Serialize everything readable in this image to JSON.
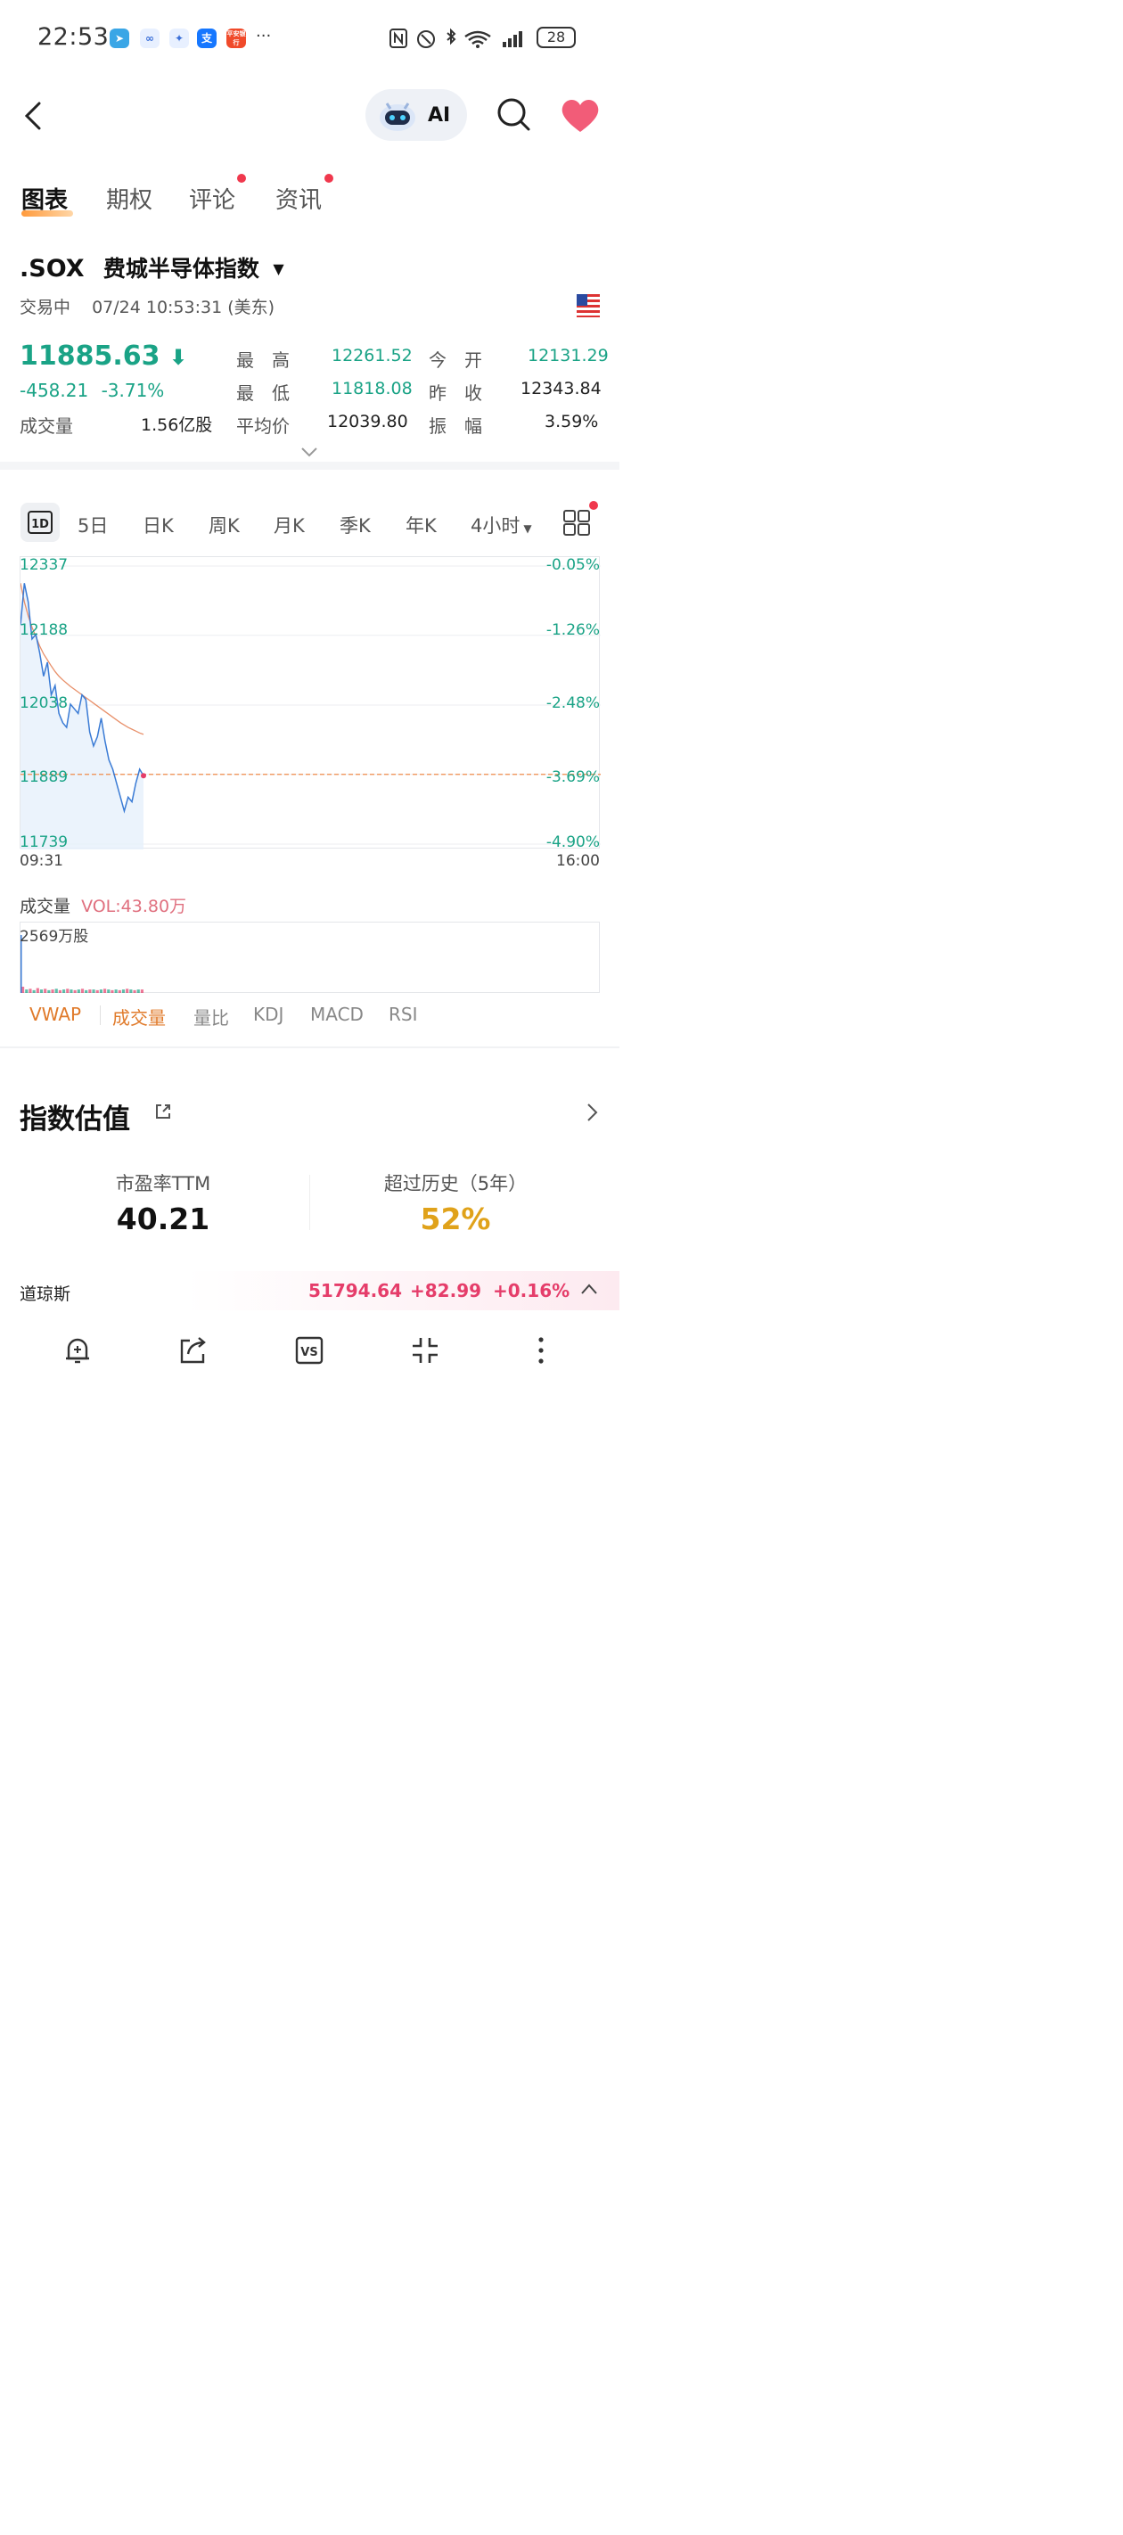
{
  "status_bar": {
    "time": "22:53",
    "more": "···",
    "battery": "28",
    "app_icons": [
      "telegram-icon",
      "app-icon",
      "rabbit-icon",
      "alipay-icon",
      "pingan-bank-icon"
    ],
    "pingan_text": "平安银行",
    "alipay_text": "支"
  },
  "header": {
    "ai_label": "AI"
  },
  "tabs": [
    {
      "label": "图表"
    },
    {
      "label": "期权"
    },
    {
      "label": "评论"
    },
    {
      "label": "资讯"
    }
  ],
  "quote": {
    "symbol": ".SOX",
    "name": "费城半导体指数",
    "status": "交易中",
    "datetime": "07/24 10:53:31 (美东)",
    "price": "11885.63",
    "change": "-458.21",
    "change_pct": "-3.71%",
    "volume_label": "成交量",
    "volume": "1.56亿股",
    "stats": [
      {
        "label": "最　高",
        "value": "12261.52",
        "color": "green"
      },
      {
        "label": "今　开",
        "value": "12131.29",
        "color": "green"
      },
      {
        "label": "最　低",
        "value": "11818.08",
        "color": "green"
      },
      {
        "label": "昨　收",
        "value": "12343.84",
        "color": "dark"
      },
      {
        "label": "平均价",
        "value": "12039.80",
        "color": "dark"
      },
      {
        "label": "振　幅",
        "value": "3.59%",
        "color": "dark"
      }
    ]
  },
  "periods": {
    "active": "1D",
    "items": [
      "5日",
      "日K",
      "周K",
      "月K",
      "季K",
      "年K",
      "4小时"
    ]
  },
  "chart": {
    "y_labels": [
      "12337",
      "12188",
      "12038",
      "11889",
      "11739"
    ],
    "pct_labels": [
      "-0.05%",
      "-1.26%",
      "-2.48%",
      "-3.69%",
      "-4.90%"
    ],
    "time_start": "09:31",
    "time_end": "16:00"
  },
  "chart_data": {
    "type": "line",
    "title": "",
    "x_range": [
      "09:31",
      "16:00"
    ],
    "ylim": [
      11739,
      12337
    ],
    "series": [
      {
        "values": [
          12210,
          12300,
          12260,
          12180,
          12190,
          12150,
          12100,
          12130,
          12060,
          12080,
          12020,
          12000,
          11990,
          12040,
          12030,
          12020,
          12060,
          12050,
          11980,
          11950,
          11970,
          12010,
          11960,
          11920,
          11900,
          11870,
          11840,
          11810,
          11840,
          11830,
          11870,
          11900,
          11886
        ]
      },
      {
        "values": [
          12300,
          12260,
          12230,
          12205,
          12185,
          12165,
          12148,
          12135,
          12122,
          12110,
          12100,
          12092,
          12085,
          12078,
          12072,
          12066,
          12060,
          12054,
          12048,
          12042,
          12036,
          12030,
          12024,
          12018,
          12012,
          12006,
          12000,
          11995,
          11990,
          11986,
          11982,
          11978,
          11975
        ]
      }
    ],
    "reference_line": 11889,
    "colors": {
      "price": "#3a7bd5",
      "avg": "#e8906a",
      "ref": "#f08a4b"
    }
  },
  "volume_section": {
    "title": "成交量",
    "vol_label": "VOL:43.80万",
    "axis_label": "2569万股"
  },
  "volume_data": {
    "values": [
      9,
      5,
      6,
      4,
      7,
      5,
      6,
      4,
      5,
      6,
      4,
      5,
      6,
      5,
      4,
      5,
      6,
      4,
      5,
      5,
      4,
      5,
      6,
      5,
      4,
      5,
      4,
      5,
      6,
      5,
      4,
      5,
      5
    ]
  },
  "indicators": [
    "VWAP",
    "成交量",
    "量比",
    "KDJ",
    "MACD",
    "RSI"
  ],
  "valuation": {
    "title": "指数估值",
    "pe_label": "市盈率TTM",
    "pe_value": "40.21",
    "hist_label": "超过历史（5年）",
    "hist_value": "52%"
  },
  "ticker": {
    "name": "道琼斯",
    "value": "51794.64",
    "change": "+82.99",
    "pct": "+0.16%"
  },
  "toolbar": [
    "alert-bell-icon",
    "share-icon",
    "vs-compare-icon",
    "collapse-icon",
    "more-vert-icon"
  ],
  "colors": {
    "up_red": "#e53d6a",
    "down_green": "#1aa386",
    "accent_orange": "#e07a2a",
    "gold": "#e0a21a"
  }
}
